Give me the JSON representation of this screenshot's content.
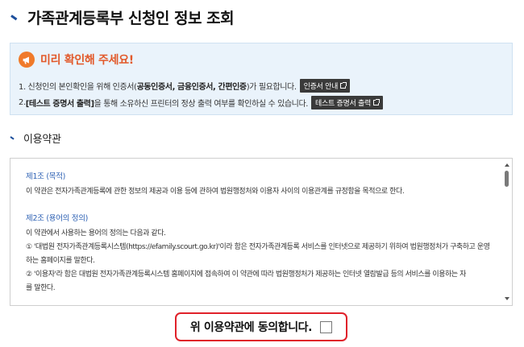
{
  "page": {
    "title": "가족관계등록부 신청인 정보 조회"
  },
  "notice": {
    "title": "미리 확인해 주세요!",
    "line1_prefix": "1. 신청인의 본인확인을 위해 인증서(",
    "line1_bold": "공동인증서, 금융인증서, 간편인증",
    "line1_suffix": ")가 필요합니다.",
    "cert_button": "인증서 안내",
    "line2_prefix": "2. ",
    "line2_bold": "[테스트 증명서 출력]",
    "line2_suffix": "을 통해 소유하신 프린터의 정상 출력 여부를 확인하실 수 있습니다.",
    "test_button": "테스트 증명서 출력"
  },
  "terms": {
    "section_title": "이용약관",
    "article1_title": "제1조 (목적)",
    "article1_text": "이 약관은 전자가족관계등록에 관한 정보의 제공과 이용 등에 관하여 법원행정처와 이용자 사이의 이용관계를 규정함을 목적으로 한다.",
    "article2_title": "제2조 (용어의 정의)",
    "article2_lines": [
      "이 약관에서 사용하는 용어의 정의는 다음과 같다.",
      "① '대법원 전자가족관계등록시스템(https://efamily.scourt.go.kr)'이라 함은 전자가족관계등록 서비스를 인터넷으로 제공하기 위하여 법원행정처가 구축하고 운영",
      "하는 홈페이지를 말한다.",
      "② '이용자'라 함은 대법원 전자가족관계등록시스템 홈페이지에 접속하여 이 약관에 따라 법원행정처가 제공하는 인터넷 열람발급 등의 서비스를 이용하는 자",
      "를 말한다."
    ]
  },
  "agree": {
    "label": "위 이용약관에 동의합니다."
  },
  "icons": {
    "notice": "megaphone-icon",
    "external": "external-link-icon"
  },
  "colors": {
    "accent_orange": "#e2592a",
    "link_blue": "#2f62b4",
    "highlight_red": "#e0212a",
    "notice_bg": "#eaf3fb"
  }
}
